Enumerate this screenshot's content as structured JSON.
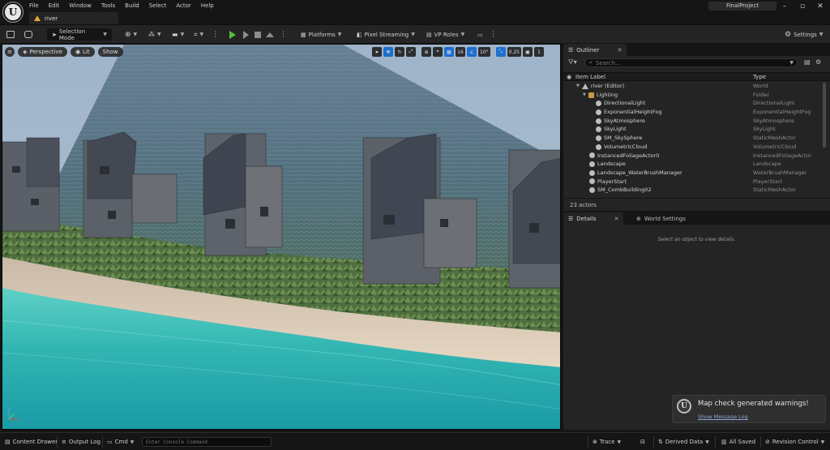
{
  "app": {
    "logo_letter": "U",
    "project_name": "FinalProject",
    "level_tab": "river"
  },
  "menu": [
    "File",
    "Edit",
    "Window",
    "Tools",
    "Build",
    "Select",
    "Actor",
    "Help"
  ],
  "toolbar": {
    "mode": "Selection Mode",
    "platforms": "Platforms",
    "pixel_streaming": "Pixel Streaming",
    "vp_roles": "VP Roles",
    "settings": "Settings"
  },
  "viewport": {
    "perspective": "Perspective",
    "lit": "Lit",
    "show": "Show",
    "grid_snap": "10",
    "rot_snap": "10°",
    "scale_snap": "0.25",
    "camera_speed": "1",
    "layers_value": "16"
  },
  "outliner": {
    "tab": "Outliner",
    "search_placeholder": "Search...",
    "col_label": "Item Label",
    "col_type": "Type",
    "rows": [
      {
        "label": "river (Editor)",
        "type": "World",
        "indent": 0,
        "icon": "world"
      },
      {
        "label": "Lighting",
        "type": "Folder",
        "indent": 1,
        "icon": "folder"
      },
      {
        "label": "DirectionalLight",
        "type": "DirectionalLight",
        "indent": 2,
        "icon": "light"
      },
      {
        "label": "ExponentialHeightFog",
        "type": "ExponentialHeightFog",
        "indent": 2,
        "icon": "fog"
      },
      {
        "label": "SkyAtmosphere",
        "type": "SkyAtmosphere",
        "indent": 2,
        "icon": "sky"
      },
      {
        "label": "SkyLight",
        "type": "SkyLight",
        "indent": 2,
        "icon": "light"
      },
      {
        "label": "SM_SkySphere",
        "type": "StaticMeshActor",
        "indent": 2,
        "icon": "mesh"
      },
      {
        "label": "VolumetricCloud",
        "type": "VolumetricCloud",
        "indent": 2,
        "icon": "cloud"
      },
      {
        "label": "InstancedFoliageActor0",
        "type": "InstancedFoliageActor",
        "indent": 1,
        "icon": "actor"
      },
      {
        "label": "Landscape",
        "type": "Landscape",
        "indent": 1,
        "icon": "landscape"
      },
      {
        "label": "Landscape_WaterBrushManager",
        "type": "WaterBrushManager",
        "indent": 1,
        "icon": "actor"
      },
      {
        "label": "PlayerStart",
        "type": "PlayerStart",
        "indent": 1,
        "icon": "actor"
      },
      {
        "label": "SM_CombBuilding02",
        "type": "StaticMeshActor",
        "indent": 1,
        "icon": "mesh"
      }
    ],
    "footer": "23 actors"
  },
  "details": {
    "tab": "Details",
    "world_settings_tab": "World Settings",
    "empty_message": "Select an object to view details."
  },
  "toast": {
    "logo_letter": "U",
    "title": "Map check generated warnings!",
    "link": "Show Message Log"
  },
  "statusbar": {
    "content_drawer": "Content Drawer",
    "output_log": "Output Log",
    "cmd": "Cmd",
    "console_placeholder": "Enter Console Command",
    "trace": "Trace",
    "derived_data": "Derived Data",
    "all_saved": "All Saved",
    "revision_control": "Revision Control"
  }
}
